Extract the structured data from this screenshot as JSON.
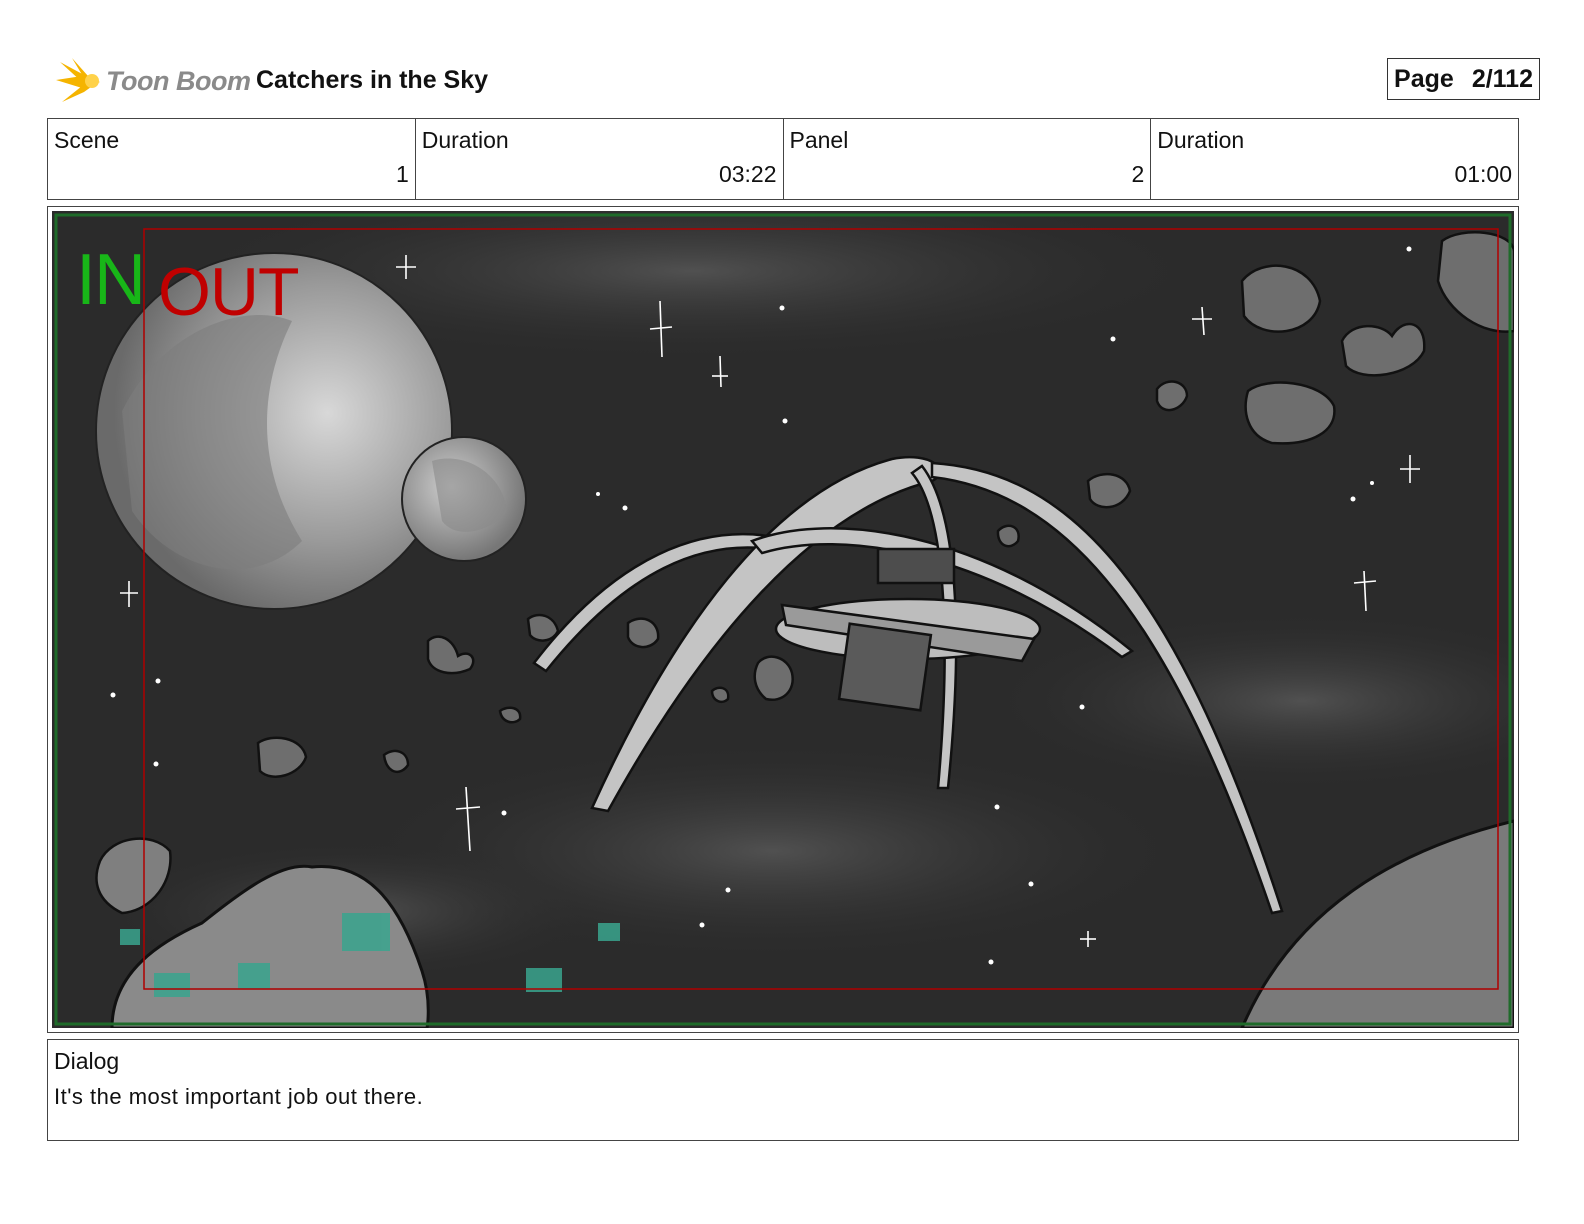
{
  "header": {
    "logo_text": "Toon Boom",
    "project_title": "Catchers in the Sky",
    "page_label": "Page",
    "page_number": "2/112"
  },
  "info": {
    "scene_label": "Scene",
    "scene_value": "1",
    "scene_duration_label": "Duration",
    "scene_duration_value": "03:22",
    "panel_label": "Panel",
    "panel_value": "2",
    "panel_duration_label": "Duration",
    "panel_duration_value": "01:00"
  },
  "panel": {
    "in_label": "IN",
    "out_label": "OUT",
    "colors": {
      "in": "#18b618",
      "out": "#c00000",
      "safe_frame": "#b00000",
      "outer_frame": "#1f6b2a"
    }
  },
  "dialog": {
    "label": "Dialog",
    "text": "It's the most important job out there."
  }
}
